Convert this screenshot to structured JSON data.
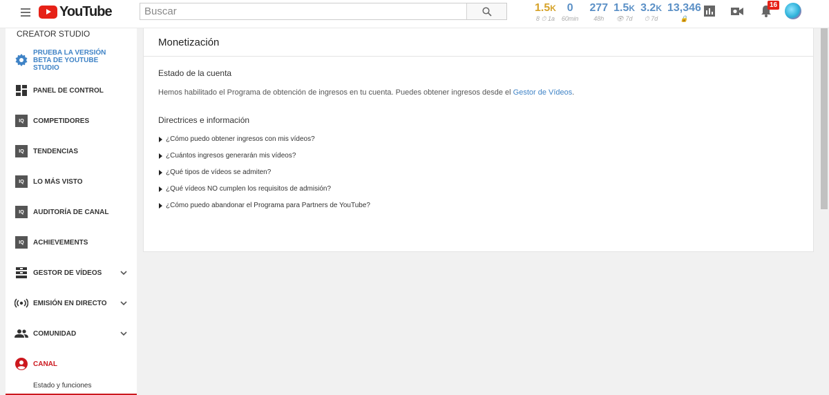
{
  "header": {
    "logo_text": "YouTube",
    "search_placeholder": "Buscar",
    "notification_count": "16",
    "stats": [
      {
        "value": "1.5",
        "unit": "K",
        "label": "8 ⏱ 1a",
        "accent": "#d6a32a"
      },
      {
        "value": "0",
        "unit": "",
        "label": "60min",
        "accent": "#5b90c6"
      },
      {
        "value": "277",
        "unit": "",
        "label": "48h",
        "accent": "#5b90c6"
      },
      {
        "value": "1.5",
        "unit": "K",
        "label": "👁 7d",
        "accent": "#5b90c6"
      },
      {
        "value": "3.2",
        "unit": "K",
        "label": "⏱ 7d",
        "accent": "#5b90c6"
      },
      {
        "value": "13,346",
        "unit": "",
        "label": "🔒",
        "accent": "#5b90c6"
      }
    ]
  },
  "sidebar": {
    "title": "CREATOR STUDIO",
    "items": [
      {
        "label": "PRUEBA LA VERSIÓN BETA DE YOUTUBE STUDIO",
        "icon": "gear-icon"
      },
      {
        "label": "PANEL DE CONTROL",
        "icon": "dashboard-icon"
      },
      {
        "label": "COMPETIDORES",
        "icon": "vidiq-icon"
      },
      {
        "label": "TENDENCIAS",
        "icon": "vidiq-icon"
      },
      {
        "label": "LO MÁS VISTO",
        "icon": "vidiq-icon"
      },
      {
        "label": "AUDITORÍA DE CANAL",
        "icon": "vidiq-icon"
      },
      {
        "label": "ACHIEVEMENTS",
        "icon": "vidiq-icon"
      },
      {
        "label": "GESTOR DE VÍDEOS",
        "icon": "video-manager-icon"
      },
      {
        "label": "EMISIÓN EN DIRECTO",
        "icon": "live-broadcast-icon"
      },
      {
        "label": "COMUNIDAD",
        "icon": "community-icon"
      },
      {
        "label": "CANAL",
        "icon": "channel-icon"
      }
    ],
    "sub_item": "Estado y funciones",
    "vidiq_badge": "IQ"
  },
  "main": {
    "title": "Monetización",
    "account_heading": "Estado de la cuenta",
    "account_text": "Hemos habilitado el Programa de obtención de ingresos en tu cuenta. Puedes obtener ingresos desde el ",
    "account_link": "Gestor de Vídeos",
    "account_text_end": ".",
    "guidelines_heading": "Directrices e información",
    "faq": [
      "¿Cómo puedo obtener ingresos con mis vídeos?",
      "¿Cuántos ingresos generarán mis vídeos?",
      "¿Qué tipos de vídeos se admiten?",
      "¿Qué vídeos NO cumplen los requisitos de admisión?",
      "¿Cómo puedo abandonar el Programa para Partners de YouTube?"
    ]
  }
}
